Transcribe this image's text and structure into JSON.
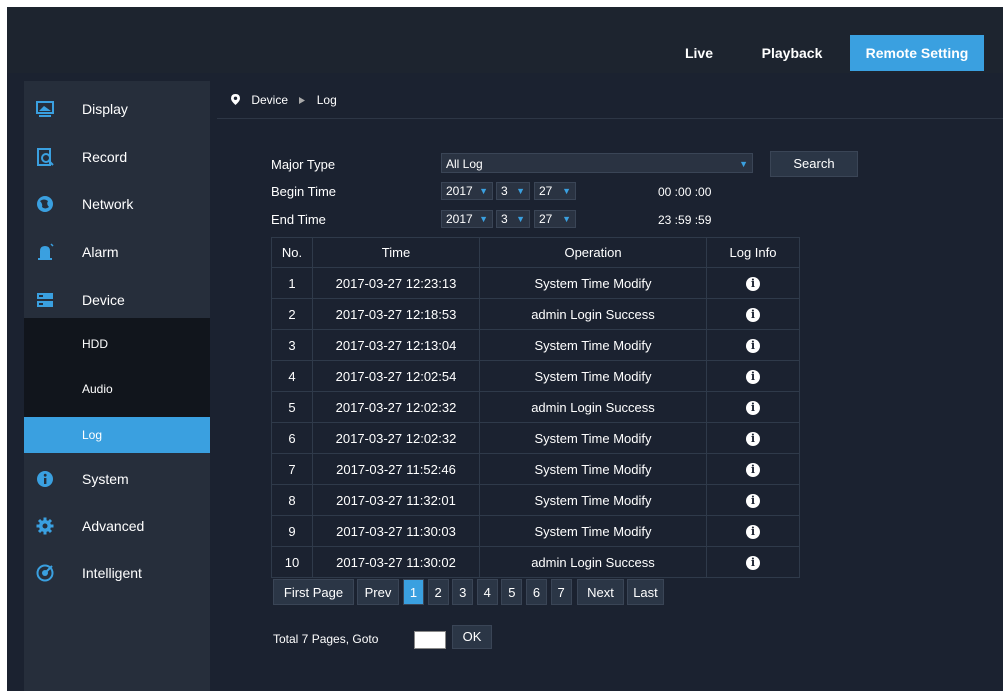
{
  "nav": {
    "live": "Live",
    "playback": "Playback",
    "remote": "Remote Setting"
  },
  "sidebar": {
    "items": [
      {
        "label": "Display",
        "icon": "display-icon"
      },
      {
        "label": "Record",
        "icon": "record-icon"
      },
      {
        "label": "Network",
        "icon": "network-icon"
      },
      {
        "label": "Alarm",
        "icon": "alarm-icon"
      },
      {
        "label": "Device",
        "icon": "device-icon"
      },
      {
        "label": "System",
        "icon": "system-icon"
      },
      {
        "label": "Advanced",
        "icon": "advanced-icon"
      },
      {
        "label": "Intelligent",
        "icon": "intelligent-icon"
      }
    ],
    "sub": [
      "HDD",
      "Audio",
      "Log"
    ]
  },
  "breadcrumb": {
    "device": "Device",
    "log": "Log"
  },
  "form": {
    "major_type_label": "Major Type",
    "major_type_value": "All Log",
    "search": "Search",
    "begin_label": "Begin Time",
    "end_label": "End Time",
    "begin": {
      "year": "2017",
      "month": "3",
      "day": "27",
      "time": "00 :00 :00"
    },
    "end": {
      "year": "2017",
      "month": "3",
      "day": "27",
      "time": "23 :59 :59"
    }
  },
  "table": {
    "headers": [
      "No.",
      "Time",
      "Operation",
      "Log Info"
    ],
    "rows": [
      [
        "1",
        "2017-03-27 12:23:13",
        "System Time Modify"
      ],
      [
        "2",
        "2017-03-27 12:18:53",
        "admin Login Success"
      ],
      [
        "3",
        "2017-03-27 12:13:04",
        "System Time Modify"
      ],
      [
        "4",
        "2017-03-27 12:02:54",
        "System Time Modify"
      ],
      [
        "5",
        "2017-03-27 12:02:32",
        "admin Login Success"
      ],
      [
        "6",
        "2017-03-27 12:02:32",
        "System Time Modify"
      ],
      [
        "7",
        "2017-03-27 11:52:46",
        "System Time Modify"
      ],
      [
        "8",
        "2017-03-27 11:32:01",
        "System Time Modify"
      ],
      [
        "9",
        "2017-03-27 11:30:03",
        "System Time Modify"
      ],
      [
        "10",
        "2017-03-27 11:30:02",
        "admin Login Success"
      ]
    ]
  },
  "pagination": {
    "first": "First Page",
    "prev": "Prev",
    "pages": [
      "1",
      "2",
      "3",
      "4",
      "5",
      "6",
      "7"
    ],
    "current": "1",
    "next": "Next",
    "last": "Last",
    "total": "Total 7 Pages, Goto",
    "ok": "OK"
  },
  "colors": {
    "accent": "#3aa0e0",
    "background": "#1b2230",
    "sidebar": "#262e3b"
  }
}
